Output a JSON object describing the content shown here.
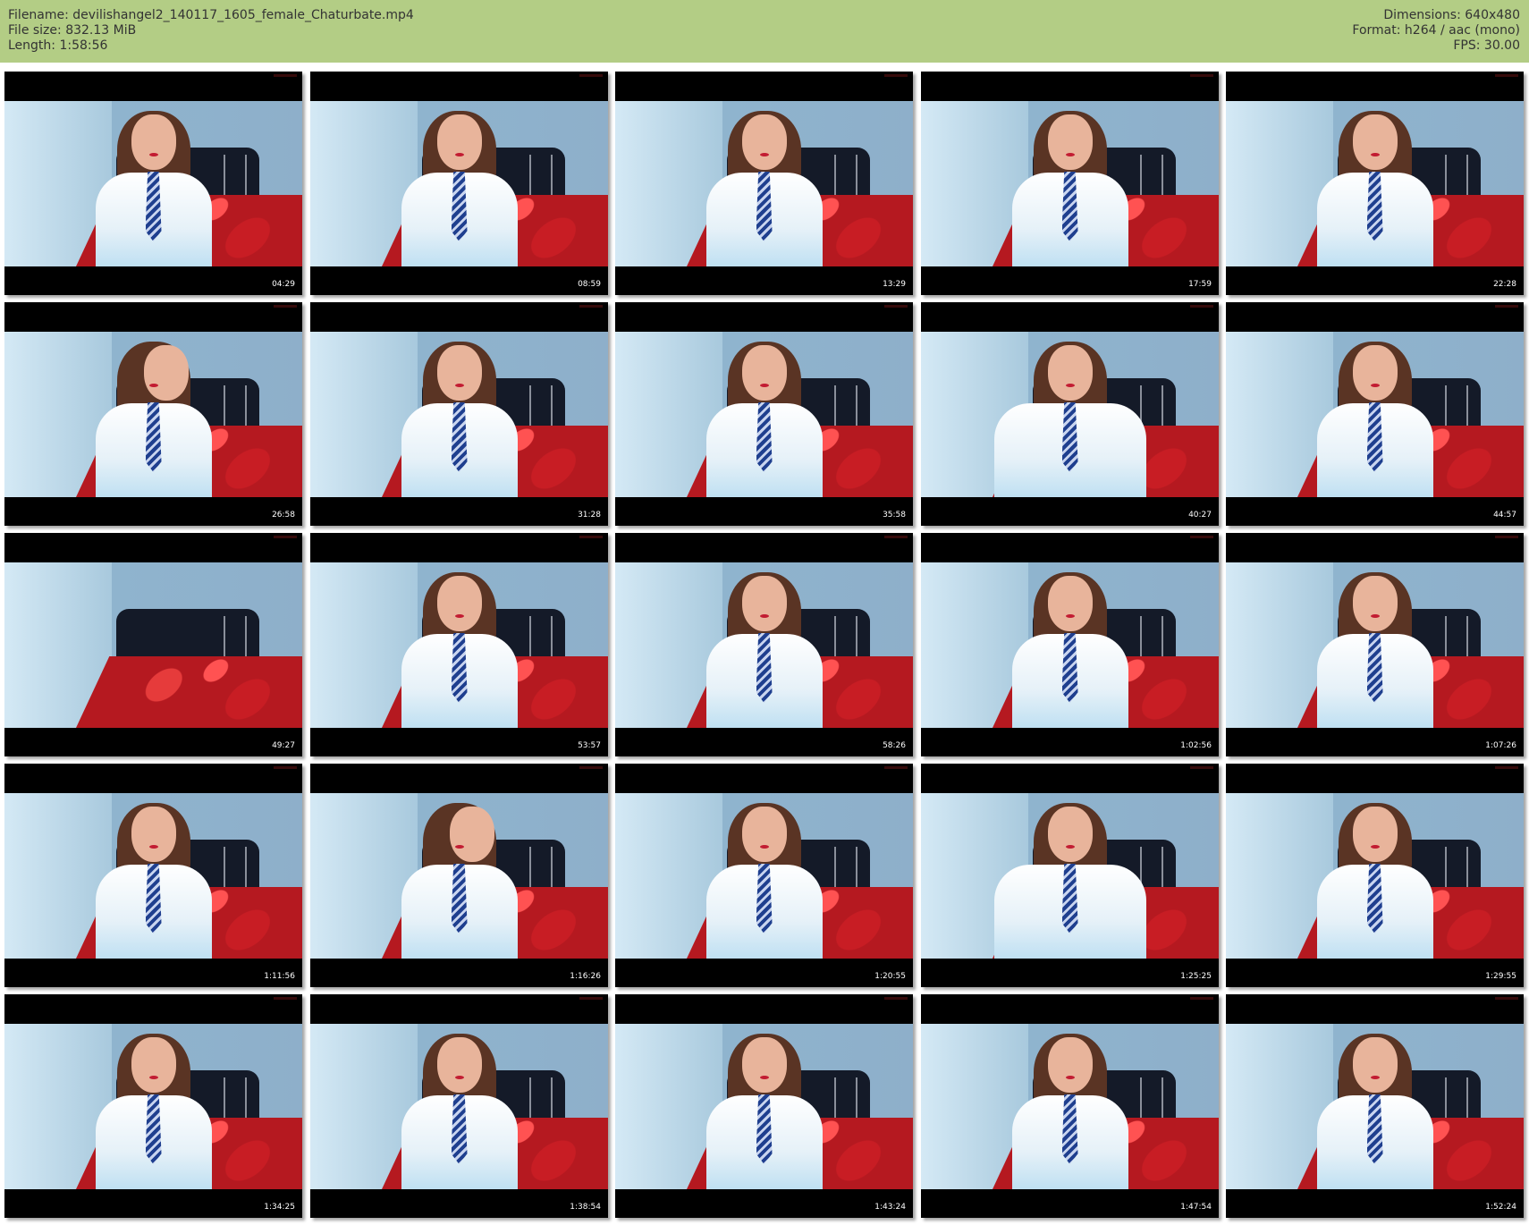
{
  "header": {
    "filename": "Filename: devilishangel2_140117_1605_female_Chaturbate.mp4",
    "filesize": "File size: 832.13 MiB",
    "length": "Length: 1:58:56",
    "dimensions": "Dimensions: 640x480",
    "format": "Format: h264 / aac (mono)",
    "fps": "FPS: 30.00"
  },
  "colors": {
    "header_bg": "#b3cd85",
    "header_text": "#333333",
    "thumb_bar": "#000000"
  },
  "thumbnails": [
    {
      "time": "04:29",
      "pose": "normal"
    },
    {
      "time": "08:59",
      "pose": "normal"
    },
    {
      "time": "13:29",
      "pose": "normal"
    },
    {
      "time": "17:59",
      "pose": "normal"
    },
    {
      "time": "22:28",
      "pose": "normal"
    },
    {
      "time": "26:58",
      "pose": "turn"
    },
    {
      "time": "31:28",
      "pose": "normal"
    },
    {
      "time": "35:58",
      "pose": "normal"
    },
    {
      "time": "40:27",
      "pose": "arms"
    },
    {
      "time": "44:57",
      "pose": "normal"
    },
    {
      "time": "49:27",
      "pose": "empty"
    },
    {
      "time": "53:57",
      "pose": "normal"
    },
    {
      "time": "58:26",
      "pose": "normal"
    },
    {
      "time": "1:02:56",
      "pose": "normal"
    },
    {
      "time": "1:07:26",
      "pose": "normal"
    },
    {
      "time": "1:11:56",
      "pose": "normal"
    },
    {
      "time": "1:16:26",
      "pose": "turn"
    },
    {
      "time": "1:20:55",
      "pose": "normal"
    },
    {
      "time": "1:25:25",
      "pose": "arms"
    },
    {
      "time": "1:29:55",
      "pose": "normal"
    },
    {
      "time": "1:34:25",
      "pose": "normal"
    },
    {
      "time": "1:38:54",
      "pose": "normal"
    },
    {
      "time": "1:43:24",
      "pose": "normal"
    },
    {
      "time": "1:47:54",
      "pose": "normal"
    },
    {
      "time": "1:52:24",
      "pose": "normal"
    }
  ]
}
